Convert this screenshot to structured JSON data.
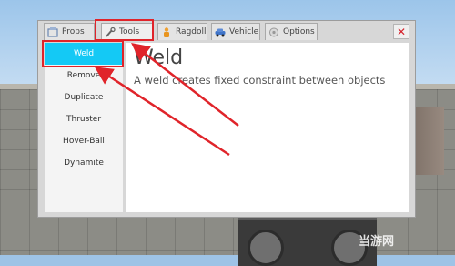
{
  "tabs": [
    {
      "label": "Props",
      "icon": "props-icon"
    },
    {
      "label": "Tools",
      "icon": "wrench-icon"
    },
    {
      "label": "Ragdoll",
      "icon": "ragdoll-icon"
    },
    {
      "label": "Vehicle",
      "icon": "car-icon"
    },
    {
      "label": "Options",
      "icon": "options-icon"
    }
  ],
  "active_tab": "Tools",
  "close": {
    "icon": "close-icon",
    "glyph": "✕"
  },
  "tools": [
    {
      "label": "Weld",
      "selected": true
    },
    {
      "label": "Remove"
    },
    {
      "label": "Duplicate"
    },
    {
      "label": "Thruster"
    },
    {
      "label": "Hover-Ball"
    },
    {
      "label": "Dynamite"
    }
  ],
  "panel": {
    "title": "Weld",
    "description": "A weld creates fixed constraint between objects"
  },
  "watermark": "当游网",
  "colors": {
    "selected": "#14c9f5",
    "annotation": "#e0242a",
    "close": "#d4202a"
  }
}
